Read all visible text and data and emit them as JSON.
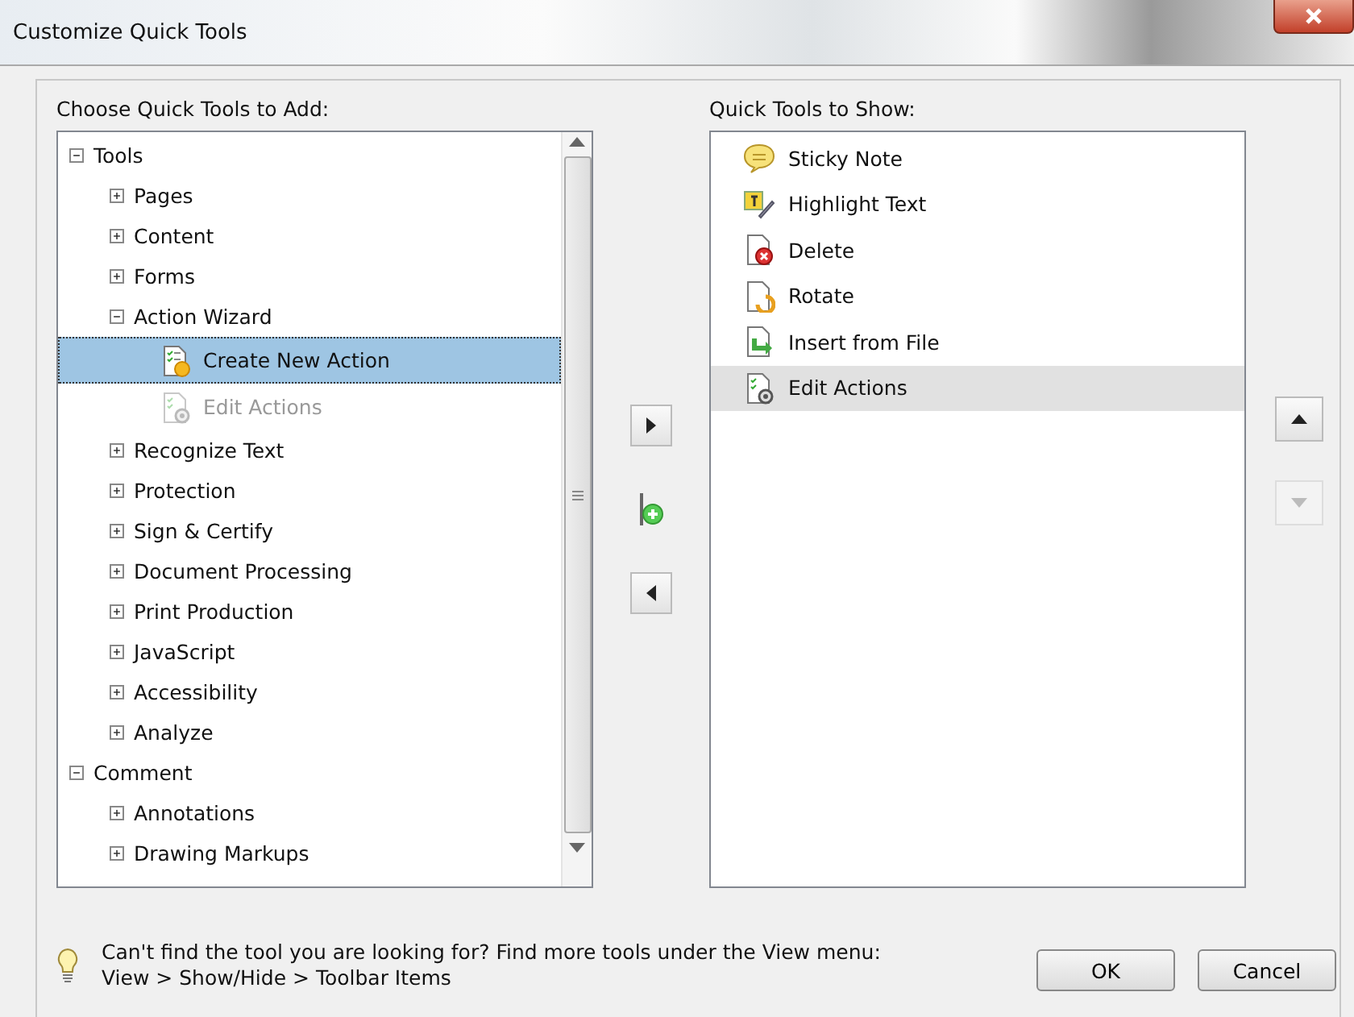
{
  "window": {
    "title": "Customize Quick Tools"
  },
  "left_panel": {
    "label": "Choose Quick Tools to Add:",
    "tree": [
      {
        "label": "Tools",
        "expanded": true,
        "selected": false,
        "children": [
          {
            "label": "Pages",
            "expanded": false,
            "selected": false
          },
          {
            "label": "Content",
            "expanded": false,
            "selected": false
          },
          {
            "label": "Forms",
            "expanded": false,
            "selected": false
          },
          {
            "label": "Action Wizard",
            "expanded": true,
            "selected": false,
            "children": [
              {
                "label": "Create New Action",
                "kind": "create-action",
                "selected": true,
                "disabled": false
              },
              {
                "label": "Edit Actions",
                "kind": "edit-actions",
                "selected": false,
                "disabled": true
              }
            ]
          },
          {
            "label": "Recognize Text",
            "expanded": false,
            "selected": false
          },
          {
            "label": "Protection",
            "expanded": false,
            "selected": false
          },
          {
            "label": "Sign & Certify",
            "expanded": false,
            "selected": false
          },
          {
            "label": "Document Processing",
            "expanded": false,
            "selected": false
          },
          {
            "label": "Print Production",
            "expanded": false,
            "selected": false
          },
          {
            "label": "JavaScript",
            "expanded": false,
            "selected": false
          },
          {
            "label": "Accessibility",
            "expanded": false,
            "selected": false
          },
          {
            "label": "Analyze",
            "expanded": false,
            "selected": false
          }
        ]
      },
      {
        "label": "Comment",
        "expanded": true,
        "selected": false,
        "children": [
          {
            "label": "Annotations",
            "expanded": false,
            "selected": false
          },
          {
            "label": "Drawing Markups",
            "expanded": false,
            "selected": false
          }
        ]
      }
    ]
  },
  "middle_buttons": [
    {
      "kind": "add",
      "disabled": false
    },
    {
      "kind": "separator",
      "disabled": false
    },
    {
      "kind": "remove",
      "disabled": false
    }
  ],
  "right_panel": {
    "label": "Quick Tools to Show:",
    "items": [
      {
        "label": "Sticky Note",
        "kind": "sticky-note",
        "selected": false
      },
      {
        "label": "Highlight Text",
        "kind": "highlight",
        "selected": false
      },
      {
        "label": "Delete",
        "kind": "delete",
        "selected": false
      },
      {
        "label": "Rotate",
        "kind": "rotate",
        "selected": false
      },
      {
        "label": "Insert from File",
        "kind": "insert",
        "selected": false
      },
      {
        "label": "Edit Actions",
        "kind": "edit-actions",
        "selected": true
      }
    ]
  },
  "order_buttons": [
    {
      "kind": "up",
      "disabled": false
    },
    {
      "kind": "down",
      "disabled": true
    }
  ],
  "footer": {
    "hint_lines": [
      "Can't find the tool you are looking for? Find more tools under the View menu:",
      "View > Show/Hide > Toolbar Items"
    ],
    "buttons": [
      "OK",
      "Cancel"
    ]
  }
}
